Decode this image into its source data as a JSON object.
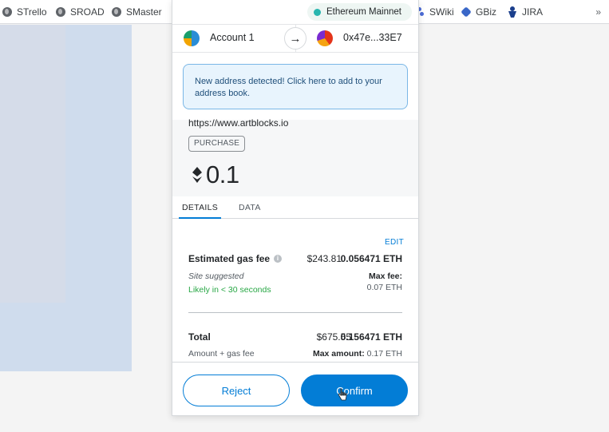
{
  "bookmarks": [
    {
      "label": "STrello",
      "icon": "globe-icon"
    },
    {
      "label": "SROAD",
      "icon": "globe-icon"
    },
    {
      "label": "SMaster",
      "icon": "globe-icon"
    },
    {
      "label": "SWiki",
      "icon": "wiki-icon"
    },
    {
      "label": "GBiz",
      "icon": "gbiz-icon"
    },
    {
      "label": "JIRA",
      "icon": "jira-icon"
    }
  ],
  "bookmarks_overflow": "»",
  "network": {
    "name": "Ethereum Mainnet",
    "color": "#29b6af"
  },
  "accounts": {
    "from_name": "Account 1",
    "to_address": "0x47e...33E7",
    "arrow": "→"
  },
  "notice": "New address detected! Click here to add to your address book.",
  "summary": {
    "origin": "https://www.artblocks.io",
    "type": "PURCHASE",
    "amount": "0.1"
  },
  "tabs": [
    {
      "label": "DETAILS",
      "active": true
    },
    {
      "label": "DATA",
      "active": false
    }
  ],
  "details": {
    "edit_label": "EDIT",
    "gas_label": "Estimated gas fee",
    "gas_info_icon": "i",
    "gas_fiat": "$243.81",
    "gas_eth": "0.056471 ETH",
    "site_suggested": "Site suggested",
    "max_fee_label": "Max fee:",
    "likely": "Likely in < 30 seconds",
    "max_fee_value": "0.07 ETH",
    "total_label": "Total",
    "total_fiat": "$675.55",
    "total_eth": "0.156471 ETH",
    "amount_gas_label": "Amount + gas fee",
    "max_amount_label": "Max amount:",
    "max_amount_value": "0.17 ETH"
  },
  "actions": {
    "reject": "Reject",
    "confirm": "Confirm"
  },
  "colors": {
    "accent": "#037dd6",
    "success": "#28a745",
    "notice_bg": "#e8f4fd"
  }
}
